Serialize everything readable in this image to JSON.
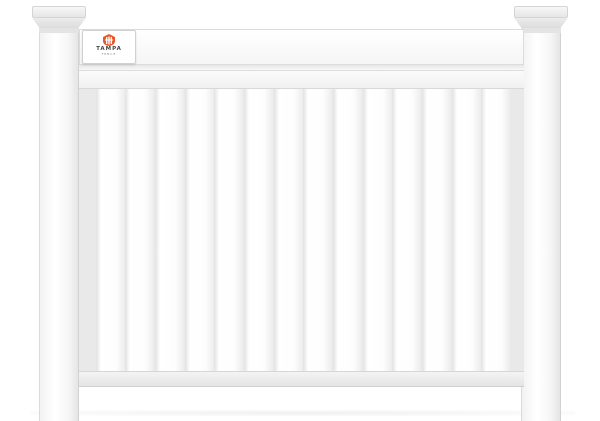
{
  "logo": {
    "name": "TAMPA",
    "tagline": "FENCE",
    "mark_icon": "fence-shield-icon",
    "mark_color": "#e8572a"
  },
  "fence": {
    "material_color": "#ffffff",
    "board_count": 14
  }
}
